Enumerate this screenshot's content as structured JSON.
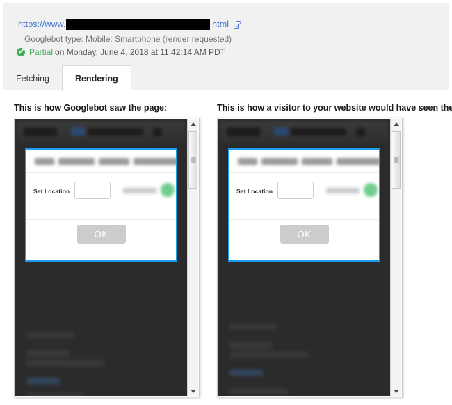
{
  "header": {
    "url_prefix": "https://www.",
    "url_redacted": "",
    "url_suffix": ".html",
    "external_link_icon": "external-link-icon",
    "googlebot_type": "Googlebot type: Mobile: Smartphone (render requested)",
    "status_icon": "check-circle-icon",
    "status_word": "Partial",
    "status_detail": "on Monday, June 4, 2018 at 11:42:14 AM PDT"
  },
  "tabs": [
    {
      "label": "Fetching",
      "active": false
    },
    {
      "label": "Rendering",
      "active": true
    }
  ],
  "sections": {
    "googlebot_heading": "This is how Googlebot saw the page:",
    "visitor_heading": "This is how a visitor to your website would have seen the page:"
  },
  "preview": {
    "modal": {
      "title_redacted": "",
      "set_location_label": "Set Location",
      "location_input_value": "",
      "location_input_placeholder": "",
      "ok_label": "OK",
      "border_color": "#1e9cec"
    },
    "scrollbar": {
      "up_arrow_icon": "scroll-up-arrow-icon",
      "down_arrow_icon": "scroll-down-arrow-icon",
      "thumb_icon": "scrollbar-thumb"
    }
  },
  "colors": {
    "link": "#3b73d4",
    "status_green": "#3fae56",
    "modal_accent": "#1e9cec",
    "header_band": "#f1f1f1",
    "preview_background": "#2b2b2b",
    "ok_button": "#cccccc"
  }
}
